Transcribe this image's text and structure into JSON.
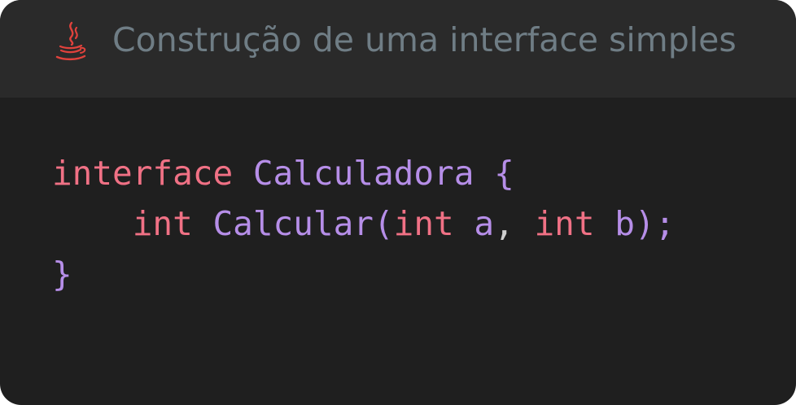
{
  "header": {
    "icon": "java-icon",
    "title": "Construção de uma interface simples"
  },
  "colors": {
    "background": "#1f1f1f",
    "header_background": "#2a2a2a",
    "title": "#6f7d85",
    "keyword": "#f07185",
    "type_name": "#b68ee8",
    "punctuation": "#b68ee8",
    "plain": "#cfcfcf",
    "icon": "#e0423c"
  },
  "code": {
    "line1": {
      "keyword": "interface",
      "name": "Calculadora",
      "open_brace": "{"
    },
    "line2": {
      "indent": "    ",
      "return_type": "int",
      "method": "Calcular",
      "open_paren": "(",
      "param1_type": "int",
      "param1_name": "a",
      "comma": ",",
      "param2_type": "int",
      "param2_name": "b",
      "close_paren_semicolon": ");"
    },
    "line3": {
      "close_brace": "}"
    }
  }
}
